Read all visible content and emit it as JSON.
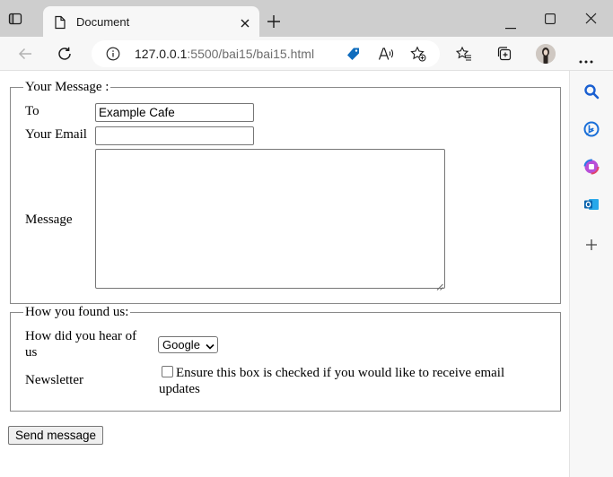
{
  "browser": {
    "tab_title": "Document",
    "url_host": "127.0.0.1",
    "url_path": ":5500/bai15/bai15.html"
  },
  "form": {
    "message_fieldset": {
      "legend": "Your Message :",
      "to_label": "To",
      "to_value": "Example Cafe",
      "email_label": "Your Email",
      "email_value": "",
      "message_label": "Message",
      "message_value": ""
    },
    "found_fieldset": {
      "legend": "How you found us:",
      "hear_label_line1": "How did you hear of",
      "hear_label_line2": "us",
      "hear_selected": "Google",
      "newsletter_label": "Newsletter",
      "newsletter_checked": false,
      "newsletter_text_line1": "Ensure this box is checked if you would like to receive email",
      "newsletter_text_line2": "updates"
    },
    "submit_label": "Send message"
  },
  "icons": {
    "sidebar": [
      "search-icon",
      "bing-chat-icon",
      "office-icon",
      "outlook-icon",
      "add-icon"
    ]
  },
  "colors": {
    "tabstrip": "#cecece",
    "toolbar": "#f7f7f7",
    "accent_blue": "#0f6cbd"
  }
}
